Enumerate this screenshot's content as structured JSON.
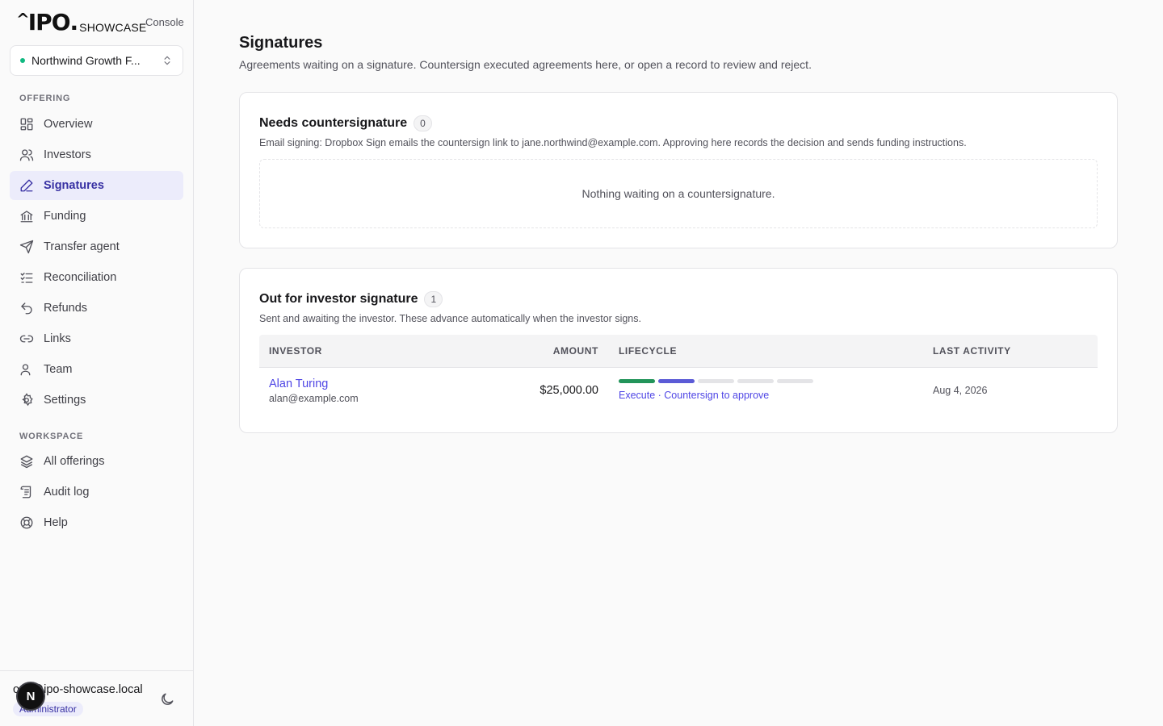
{
  "brand": {
    "mark": "IPO",
    "caret": "^",
    "dot": ".",
    "sub": "SHOWCASE",
    "console": "Console"
  },
  "org": {
    "name": "Northwind Growth F...",
    "status_color": "#10b981"
  },
  "sidebar": {
    "offering_label": "OFFERING",
    "offering_items": [
      {
        "label": "Overview",
        "icon": "grid-icon"
      },
      {
        "label": "Investors",
        "icon": "users-icon"
      },
      {
        "label": "Signatures",
        "icon": "pen-icon",
        "active": true
      },
      {
        "label": "Funding",
        "icon": "bank-icon"
      },
      {
        "label": "Transfer agent",
        "icon": "send-icon"
      },
      {
        "label": "Reconciliation",
        "icon": "checklist-icon"
      },
      {
        "label": "Refunds",
        "icon": "undo-icon"
      },
      {
        "label": "Links",
        "icon": "link-icon"
      },
      {
        "label": "Team",
        "icon": "user-icon"
      },
      {
        "label": "Settings",
        "icon": "gear-icon"
      }
    ],
    "workspace_label": "WORKSPACE",
    "workspace_items": [
      {
        "label": "All offerings",
        "icon": "layers-icon"
      },
      {
        "label": "Audit log",
        "icon": "scroll-icon"
      },
      {
        "label": "Help",
        "icon": "lifebuoy-icon"
      }
    ]
  },
  "user": {
    "avatar_initial": "N",
    "email": "ops@ipo-showcase.local",
    "role": "Administrator"
  },
  "page": {
    "title": "Signatures",
    "subtitle": "Agreements waiting on a signature. Countersign executed agreements here, or open a record to review and reject."
  },
  "needs_countersignature": {
    "title": "Needs countersignature",
    "count": "0",
    "description": "Email signing: Dropbox Sign emails the countersign link to jane.northwind@example.com. Approving here records the decision and sends funding instructions.",
    "empty_text": "Nothing waiting on a countersignature."
  },
  "out_for_signature": {
    "title": "Out for investor signature",
    "count": "1",
    "description": "Sent and awaiting the investor. These advance automatically when the investor signs.",
    "columns": {
      "investor": "INVESTOR",
      "amount": "AMOUNT",
      "lifecycle": "LIFECYCLE",
      "last_activity": "LAST ACTIVITY"
    },
    "rows": [
      {
        "name": "Alan Turing",
        "email": "alan@example.com",
        "amount": "$25,000.00",
        "lifecycle_steps": [
          "#22945a",
          "#5b5bd6",
          "#e4e4e7",
          "#e4e4e7",
          "#e4e4e7"
        ],
        "lifecycle_text": "Execute · Countersign to approve",
        "last_activity": "Aug 4, 2026"
      }
    ]
  },
  "colors": {
    "accent": "#4f46e5",
    "active_bg": "#ececfb",
    "done": "#22945a",
    "current": "#5b5bd6"
  }
}
